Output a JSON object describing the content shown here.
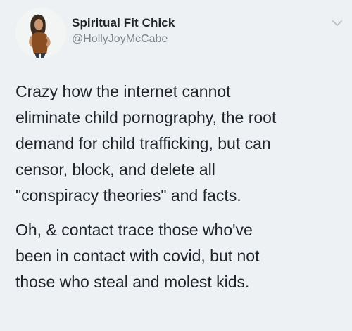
{
  "tweet": {
    "display_name": "Spiritual Fit Chick",
    "handle": "@HollyJoyMcCabe",
    "paragraphs": [
      "Crazy how the internet cannot\neliminate child pornography, the root\ndemand for child trafficking, but can\ncensor, block, and delete all\n\"conspiracy theories\" and facts.",
      "Oh, & contact trace those who've\nbeen in contact with covid, but not\nthose who steal and molest kids."
    ]
  },
  "icons": {
    "avatar": "profile-photo",
    "menu": "chevron-down-icon"
  },
  "colors": {
    "background": "#eef1f4",
    "name": "#222222",
    "handle": "#7d848b",
    "text": "#1f2428"
  }
}
